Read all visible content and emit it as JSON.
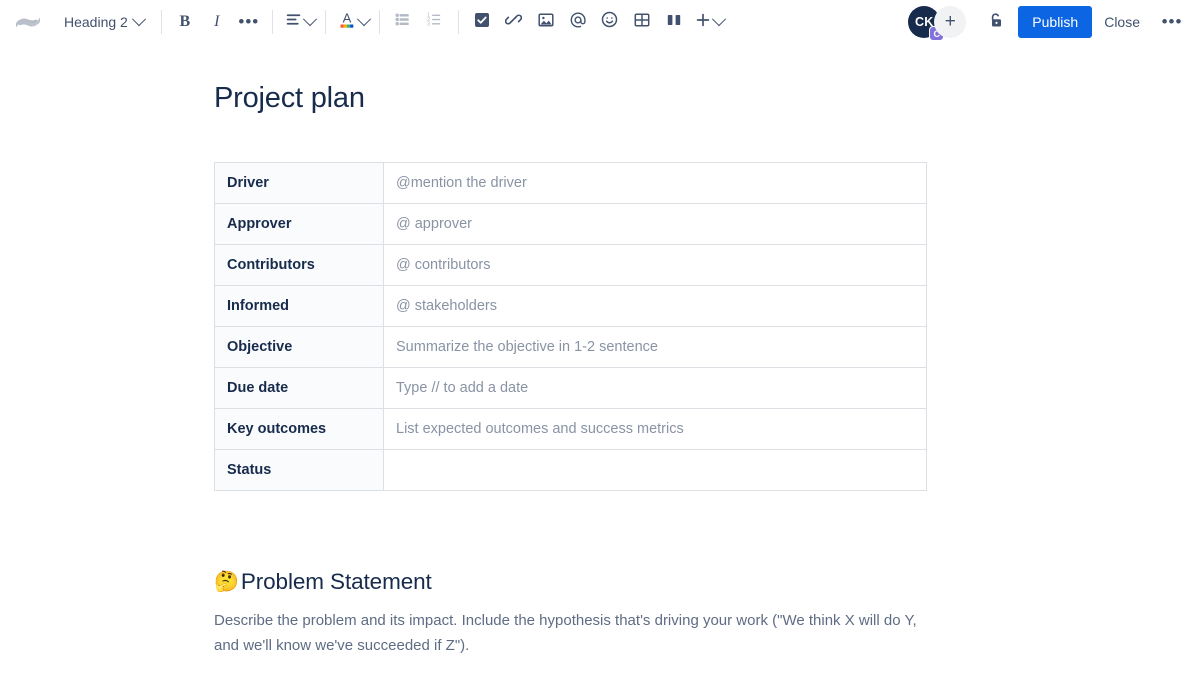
{
  "toolbar": {
    "logo_icon": "confluence-logo",
    "heading_select": {
      "label": "Heading 2",
      "icon": "chevron-down-icon"
    },
    "bold_label": "B",
    "italic_label": "I",
    "more_formatting_label": "•••",
    "align_icon": "align-left-icon",
    "text_color_label": "A",
    "bullet_list_icon": "bullet-list-icon",
    "numbered_list_icon": "numbered-list-icon",
    "task_icon": "checkbox-task-icon",
    "link_icon": "link-icon",
    "image_icon": "image-icon",
    "mention_icon": "mention-at-icon",
    "emoji_icon": "emoji-smiley-icon",
    "table_icon": "table-icon",
    "layout_icon": "layout-columns-icon",
    "insert_label": "+",
    "avatar": {
      "initials": "CK",
      "badge": "C",
      "badge_color": "#8270db",
      "bg_color": "#172b4d"
    },
    "add_people_label": "+",
    "restrictions_icon": "unlock-icon",
    "publish_label": "Publish",
    "publish_color": "#0c66e4",
    "close_label": "Close",
    "more_actions_label": "•••"
  },
  "document": {
    "title": "Project plan",
    "table": {
      "rows": [
        {
          "label": "Driver",
          "value": "@mention the driver"
        },
        {
          "label": "Approver",
          "value": "@ approver"
        },
        {
          "label": "Contributors",
          "value": "@ contributors"
        },
        {
          "label": "Informed",
          "value": "@ stakeholders"
        },
        {
          "label": "Objective",
          "value": "Summarize the objective in 1-2 sentence"
        },
        {
          "label": "Due date",
          "value": "Type // to add a date"
        },
        {
          "label": "Key outcomes",
          "value": "List expected outcomes and success metrics"
        },
        {
          "label": "Status",
          "value": ""
        }
      ]
    },
    "sections": [
      {
        "emoji": "🤔",
        "heading": "Problem Statement",
        "body": "Describe the problem and its impact. Include the hypothesis that's driving your work (\"We think X will do Y, and we'll know we've succeeded if Z\")."
      }
    ]
  }
}
